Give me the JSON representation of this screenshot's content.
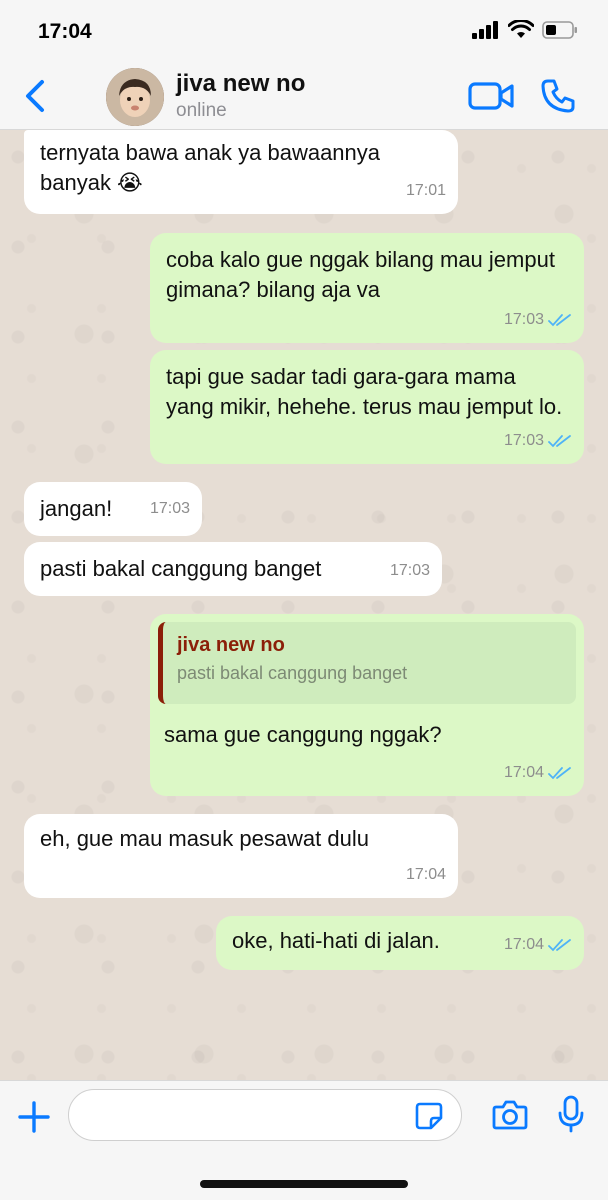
{
  "status_bar": {
    "time": "17:04"
  },
  "header": {
    "contact_name": "jiva new no",
    "contact_status": "online"
  },
  "icons": {
    "back": "chevron-left-icon",
    "video": "video-camera-icon",
    "call": "phone-icon",
    "add": "plus-icon",
    "sticker": "sticker-icon",
    "camera": "camera-icon",
    "mic": "microphone-icon",
    "read_receipt": "double-check-icon"
  },
  "colors": {
    "accent": "#0a7aff",
    "incoming_bubble": "#ffffff",
    "outgoing_bubble": "#dcf8c6",
    "read_tick": "#4fb3f7",
    "quote_name": "#8b1f08",
    "chat_background": "#e6ddd4"
  },
  "messages": [
    {
      "direction": "in",
      "text": "ternyata bawa anak ya bawaannya banyak 😭",
      "time": "17:01"
    },
    {
      "direction": "out",
      "text": "coba kalo gue nggak bilang mau jemput gimana? bilang aja va",
      "time": "17:03",
      "read": true
    },
    {
      "direction": "out",
      "text": "tapi gue sadar tadi gara-gara mama yang mikir, hehehe. terus mau jemput lo.",
      "time": "17:03",
      "read": true
    },
    {
      "direction": "in",
      "text": "jangan!",
      "time": "17:03"
    },
    {
      "direction": "in",
      "text": "pasti bakal canggung banget",
      "time": "17:03"
    },
    {
      "direction": "out",
      "reply_to": {
        "name": "jiva new no",
        "text": "pasti bakal canggung banget"
      },
      "text": "sama gue canggung nggak?",
      "time": "17:04",
      "read": true
    },
    {
      "direction": "in",
      "text": "eh, gue mau masuk pesawat dulu",
      "time": "17:04"
    },
    {
      "direction": "out",
      "text": "oke, hati-hati di jalan.",
      "time": "17:04",
      "read": true
    }
  ],
  "composer": {
    "value": "",
    "placeholder": ""
  }
}
